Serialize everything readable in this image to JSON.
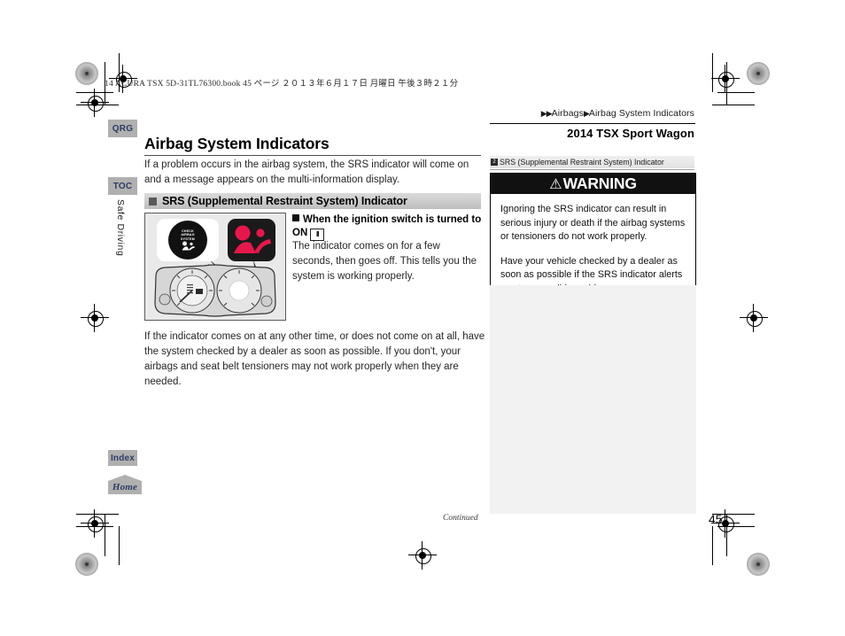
{
  "print_header": {
    "book_line": "14 ACURA TSX 5D-31TL76300.book    45 ページ    ２０１３年６月１７日    月曜日    午後３時２１分"
  },
  "breadcrumb": {
    "arrow1": "▶▶",
    "crumb1": "Airbags",
    "arrow2": "▶",
    "crumb2": "Airbag System Indicators"
  },
  "model_label": "2014 TSX Sport Wagon",
  "sidebar_tabs": {
    "qrg": "QRG",
    "toc": "TOC",
    "index": "Index",
    "home": "Home",
    "section_label": "Safe Driving"
  },
  "main": {
    "heading": "Airbag System Indicators",
    "intro": "If a problem occurs in the airbag system, the SRS indicator will come on and a message appears on the multi-information display.",
    "section_heading": "SRS (Supplemental Restraint System) Indicator",
    "figure": {
      "callout_text_line1": "CHECK",
      "callout_text_line2": "AIRBAG",
      "callout_text_line3": "SYSTEM",
      "srs_icon_color": "#E8174B",
      "callout_white_name": "check-airbag-system-message",
      "callout_black_name": "srs-indicator-symbol"
    },
    "subheading": "When the ignition switch is turned to ON",
    "ignition_key": "II",
    "sub_paragraph": "The indicator comes on for a few seconds, then goes off. This tells you the system is working properly.",
    "body_paragraph": "If the indicator comes on at any other time, or does not come on at all, have the system checked by a dealer as soon as possible. If you don't, your airbags and seat belt tensioners may not work properly when they are needed."
  },
  "side": {
    "marker": "2",
    "header": "SRS (Supplemental Restraint System) Indicator",
    "warning_title": "WARNING",
    "warning_symbol": "⚠",
    "warning_paragraph_1": "Ignoring the SRS indicator can result in serious injury or death if the airbag systems or tensioners do not work properly.",
    "warning_paragraph_2": "Have your vehicle checked by a dealer as soon as possible if the SRS indicator alerts you to a possible problem."
  },
  "footer": {
    "continued": "Continued",
    "page_number": "45"
  },
  "colors": {
    "warning_bar": "#111111",
    "srs_red": "#E8174B",
    "tab_gray": "#b0b0b0",
    "tab_text": "#2c3c66",
    "panel_gray": "#f2f2f2"
  }
}
